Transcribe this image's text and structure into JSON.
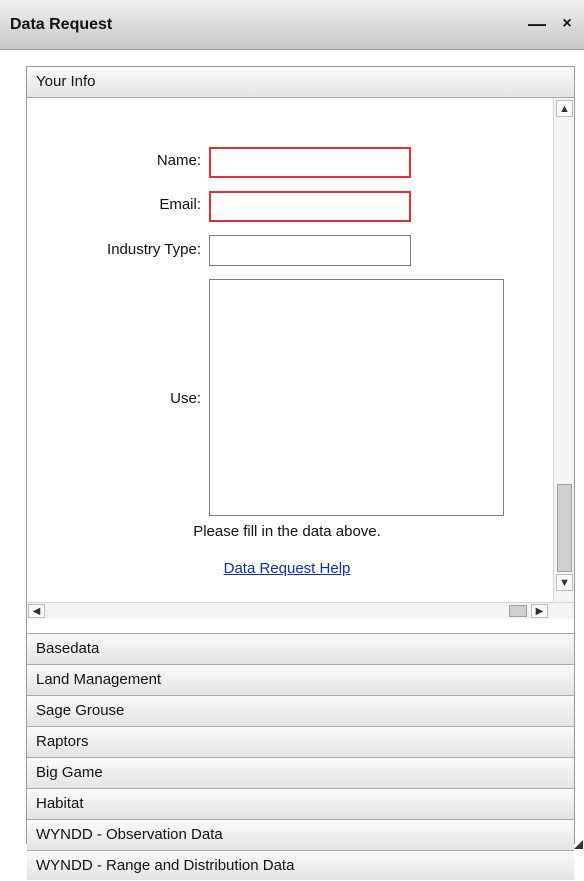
{
  "window": {
    "title": "Data Request",
    "minimize_glyph": "—",
    "close_glyph": "×"
  },
  "your_info": {
    "header": "Your Info",
    "name_label": "Name:",
    "name_value": "",
    "email_label": "Email:",
    "email_value": "",
    "industry_label": "Industry Type:",
    "industry_value": "",
    "use_label": "Use:",
    "use_value": "",
    "message": "Please fill in the data above.",
    "help_link": "Data Request Help"
  },
  "scrollbars": {
    "up_glyph": "▲",
    "down_glyph": "▼",
    "left_glyph": "◀",
    "right_glyph": "▶"
  },
  "sections": [
    "Basedata",
    "Land Management",
    "Sage Grouse",
    "Raptors",
    "Big Game",
    "Habitat",
    "WYNDD - Observation Data",
    "WYNDD - Range and Distribution Data"
  ],
  "colors": {
    "required_border": "#e03030",
    "link": "#0b2bd6"
  }
}
